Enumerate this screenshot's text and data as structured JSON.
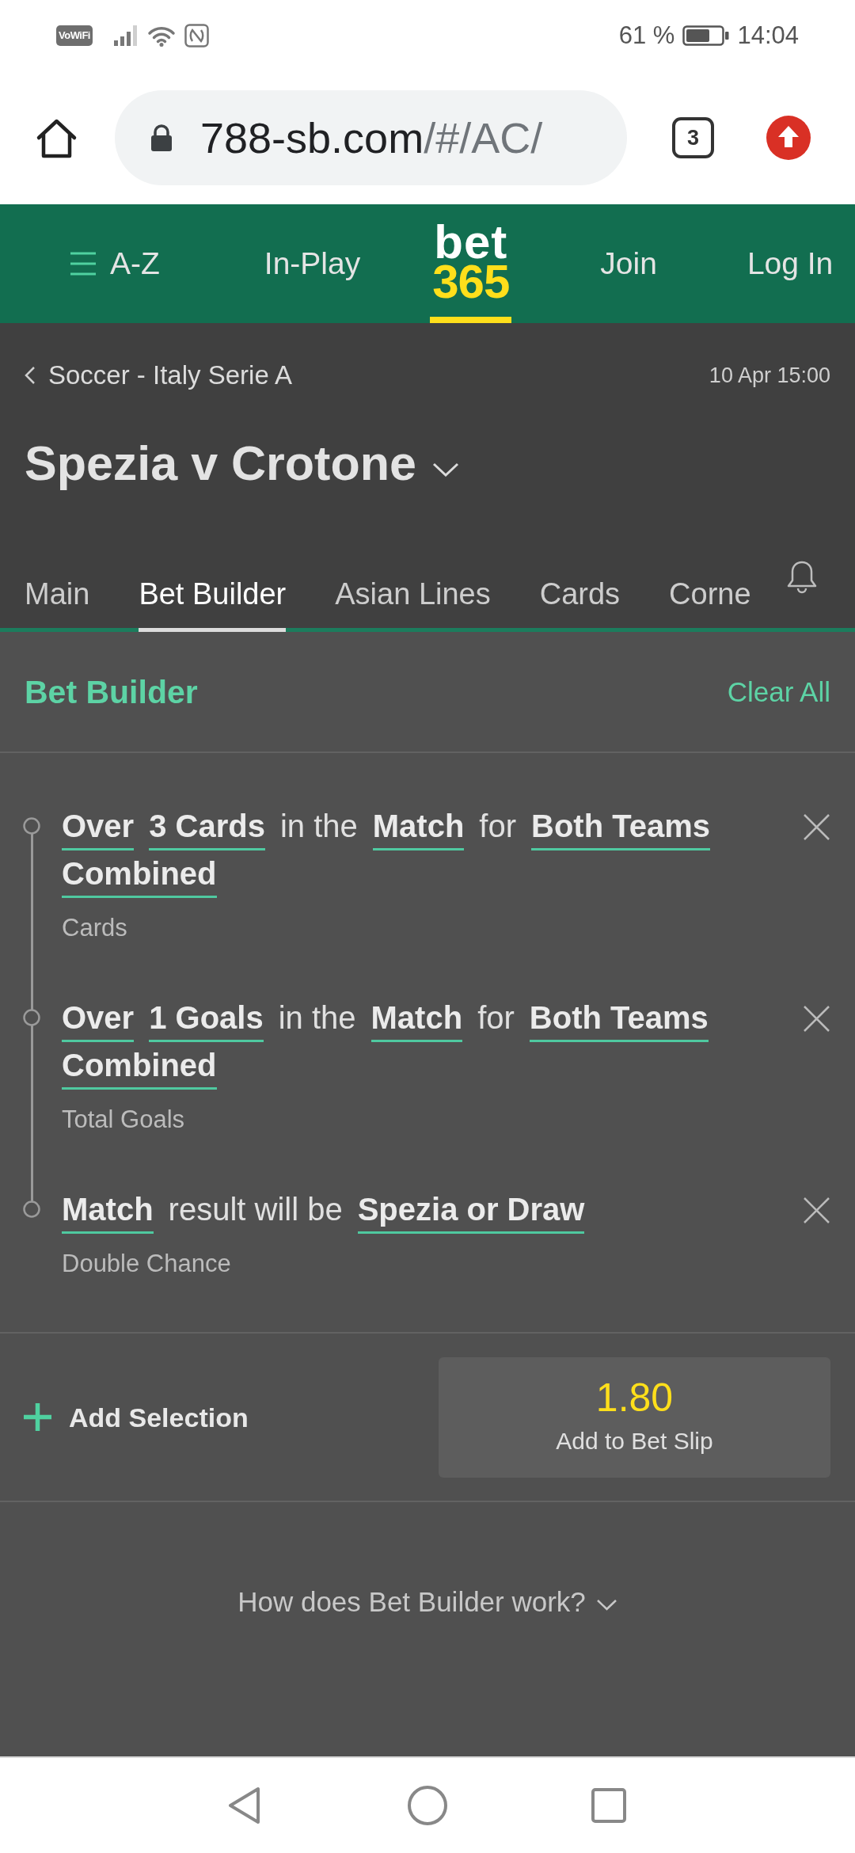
{
  "status_bar": {
    "network_badge": "VoWiFi",
    "battery": "61 %",
    "time": "14:04"
  },
  "browser": {
    "url_host": "788-sb.com",
    "url_path": "/#/AC/",
    "tab_count": "3"
  },
  "nav": {
    "items": [
      {
        "kind": "menu",
        "label": "A-Z",
        "selected": false
      },
      {
        "kind": "link",
        "label": "In-Play",
        "selected": false
      },
      {
        "kind": "logo",
        "label": "bet",
        "sublabel": "365",
        "selected": true
      },
      {
        "kind": "link",
        "label": "Join",
        "selected": false
      },
      {
        "kind": "link",
        "label": "Log In",
        "selected": false
      }
    ]
  },
  "event": {
    "breadcrumb": "Soccer - Italy Serie A",
    "start_time": "10 Apr 15:00",
    "title": "Spezia v Crotone"
  },
  "tabs": [
    {
      "label": "Main",
      "selected": false
    },
    {
      "label": "Bet Builder",
      "selected": true
    },
    {
      "label": "Asian Lines",
      "selected": false
    },
    {
      "label": "Cards",
      "selected": false
    },
    {
      "label": "Corne",
      "selected": false
    }
  ],
  "bet_builder": {
    "title": "Bet Builder",
    "clear_all": "Clear All",
    "selections": [
      {
        "parts": [
          {
            "kind": "option",
            "text": "Over"
          },
          {
            "kind": "option",
            "text": "3 Cards"
          },
          {
            "kind": "text",
            "text": "in the"
          },
          {
            "kind": "option",
            "text": "Match"
          },
          {
            "kind": "text",
            "text": "for"
          },
          {
            "kind": "option",
            "text": "Both Teams"
          },
          {
            "kind": "option",
            "text": "Combined"
          }
        ],
        "market": "Cards"
      },
      {
        "parts": [
          {
            "kind": "option",
            "text": "Over"
          },
          {
            "kind": "option",
            "text": "1 Goals"
          },
          {
            "kind": "text",
            "text": "in the"
          },
          {
            "kind": "option",
            "text": "Match"
          },
          {
            "kind": "text",
            "text": "for"
          },
          {
            "kind": "option",
            "text": "Both Teams"
          },
          {
            "kind": "option",
            "text": "Combined"
          }
        ],
        "market": "Total Goals"
      },
      {
        "parts": [
          {
            "kind": "option",
            "text": "Match"
          },
          {
            "kind": "text",
            "text": "result will be"
          },
          {
            "kind": "option",
            "text": "Spezia or Draw"
          }
        ],
        "market": "Double Chance"
      }
    ]
  },
  "footer": {
    "add_selection": "Add Selection",
    "odds": "1.80",
    "add_to_bet_slip": "Add to Bet Slip",
    "help": "How does Bet Builder work?"
  }
}
